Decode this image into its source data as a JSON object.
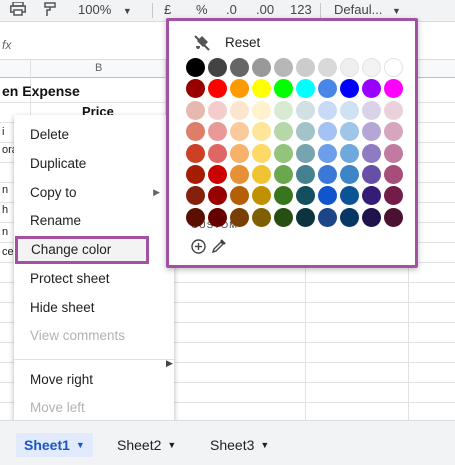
{
  "toolbar": {
    "zoom": "100%",
    "currency": "£",
    "percent": "%",
    "decrease_decimals": ".0",
    "increase_decimals": ".00",
    "more_formats": "123",
    "font": "Defaul..."
  },
  "formula_bar": {
    "fx": "fx"
  },
  "grid": {
    "column_letter": "B",
    "title_text": "en Expense",
    "price_header": "Price",
    "row_fragments": [
      "i",
      "ora",
      "n",
      "h",
      "n",
      "ce"
    ]
  },
  "context_menu": {
    "items": [
      {
        "label": "Delete"
      },
      {
        "label": "Duplicate"
      },
      {
        "label": "Copy to"
      },
      {
        "label": "Rename"
      },
      {
        "label": "Change color"
      },
      {
        "label": "Protect sheet"
      },
      {
        "label": "Hide sheet"
      },
      {
        "label": "View comments"
      },
      {
        "label": "Move right"
      },
      {
        "label": "Move left"
      }
    ]
  },
  "color_palette": {
    "reset_label": "Reset",
    "custom_label": "CUSTOM",
    "rows": [
      [
        "#000000",
        "#434343",
        "#666666",
        "#999999",
        "#b7b7b7",
        "#cccccc",
        "#d9d9d9",
        "#efefef",
        "#f3f3f3",
        "#ffffff"
      ],
      [
        "#980000",
        "#ff0000",
        "#ff9900",
        "#ffff00",
        "#00ff00",
        "#00ffff",
        "#4a86e8",
        "#0000ff",
        "#9900ff",
        "#ff00ff"
      ],
      [
        "#e6b8af",
        "#f4cccc",
        "#fce5cd",
        "#fff2cc",
        "#d9ead3",
        "#d0e0e3",
        "#c9daf8",
        "#cfe2f3",
        "#d9d2e9",
        "#ead1dc"
      ],
      [
        "#dd7e6b",
        "#ea9999",
        "#f9cb9c",
        "#ffe599",
        "#b6d7a8",
        "#a2c4c9",
        "#a4c2f4",
        "#9fc5e8",
        "#b4a7d6",
        "#d5a6bd"
      ],
      [
        "#cc4125",
        "#e06666",
        "#f6b26b",
        "#ffd966",
        "#93c47d",
        "#76a5af",
        "#6d9eeb",
        "#6fa8dc",
        "#8e7cc3",
        "#c27ba0"
      ],
      [
        "#a61c00",
        "#cc0000",
        "#e69138",
        "#f1c232",
        "#6aa84f",
        "#45818e",
        "#3c78d8",
        "#3d85c6",
        "#674ea7",
        "#a64d79"
      ],
      [
        "#85200c",
        "#990000",
        "#b45f06",
        "#bf9000",
        "#38761d",
        "#134f5c",
        "#1155cc",
        "#0b5394",
        "#351c75",
        "#741b47"
      ],
      [
        "#5b0f00",
        "#660000",
        "#783f04",
        "#7f6000",
        "#274e13",
        "#0c343d",
        "#1c4587",
        "#073763",
        "#20124d",
        "#4c1130"
      ]
    ]
  },
  "sheet_tabs": [
    {
      "label": "Sheet1",
      "active": true
    },
    {
      "label": "Sheet2",
      "active": false
    },
    {
      "label": "Sheet3",
      "active": false
    }
  ],
  "colors": {
    "highlight_border": "#a351a5",
    "active_tab_bg": "#e1ebfd",
    "active_tab_text": "#1a56c8"
  },
  "icons": [
    "print-icon",
    "paint-format-icon",
    "chevron-down-icon",
    "no-color-icon",
    "add-custom-color-icon",
    "eyedropper-icon",
    "submenu-arrow-icon"
  ]
}
